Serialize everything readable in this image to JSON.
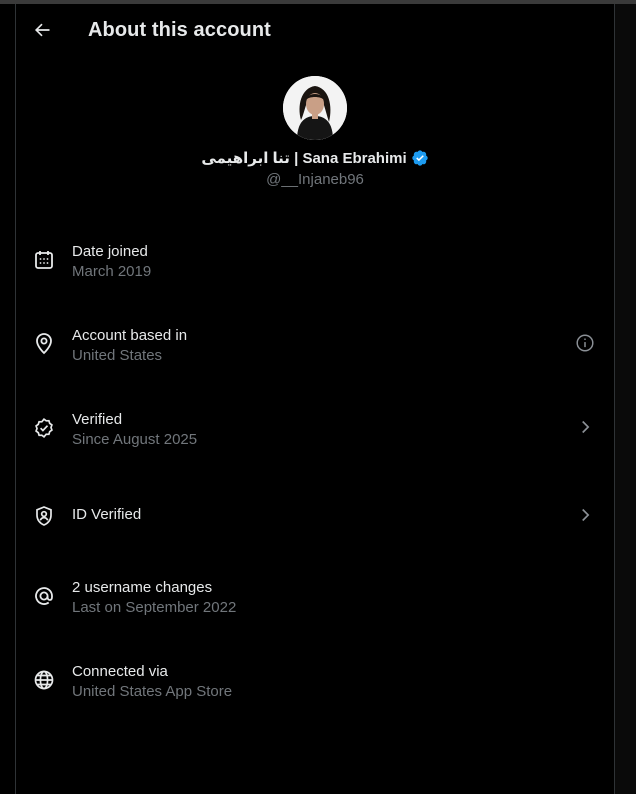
{
  "header": {
    "title": "About this account"
  },
  "profile": {
    "display_name": "تنا ابراهیمی | Sana Ebrahimi",
    "handle": "@__Injaneb96",
    "verified_color": "#1d9bf0"
  },
  "items": [
    {
      "icon": "calendar-icon",
      "title": "Date joined",
      "sub": "March 2019"
    },
    {
      "icon": "location-pin-icon",
      "title": "Account based in",
      "sub": "United States",
      "right_icon": "info-icon"
    },
    {
      "icon": "verified-badge-icon",
      "title": "Verified",
      "sub": "Since August 2025",
      "right_icon": "chevron-right-icon"
    },
    {
      "icon": "id-shield-icon",
      "title": "ID Verified",
      "right_icon": "chevron-right-icon"
    },
    {
      "icon": "at-sign-icon",
      "title": "2 username changes",
      "sub": "Last on September 2022"
    },
    {
      "icon": "globe-icon",
      "title": "Connected via",
      "sub": "United States App Store"
    }
  ]
}
